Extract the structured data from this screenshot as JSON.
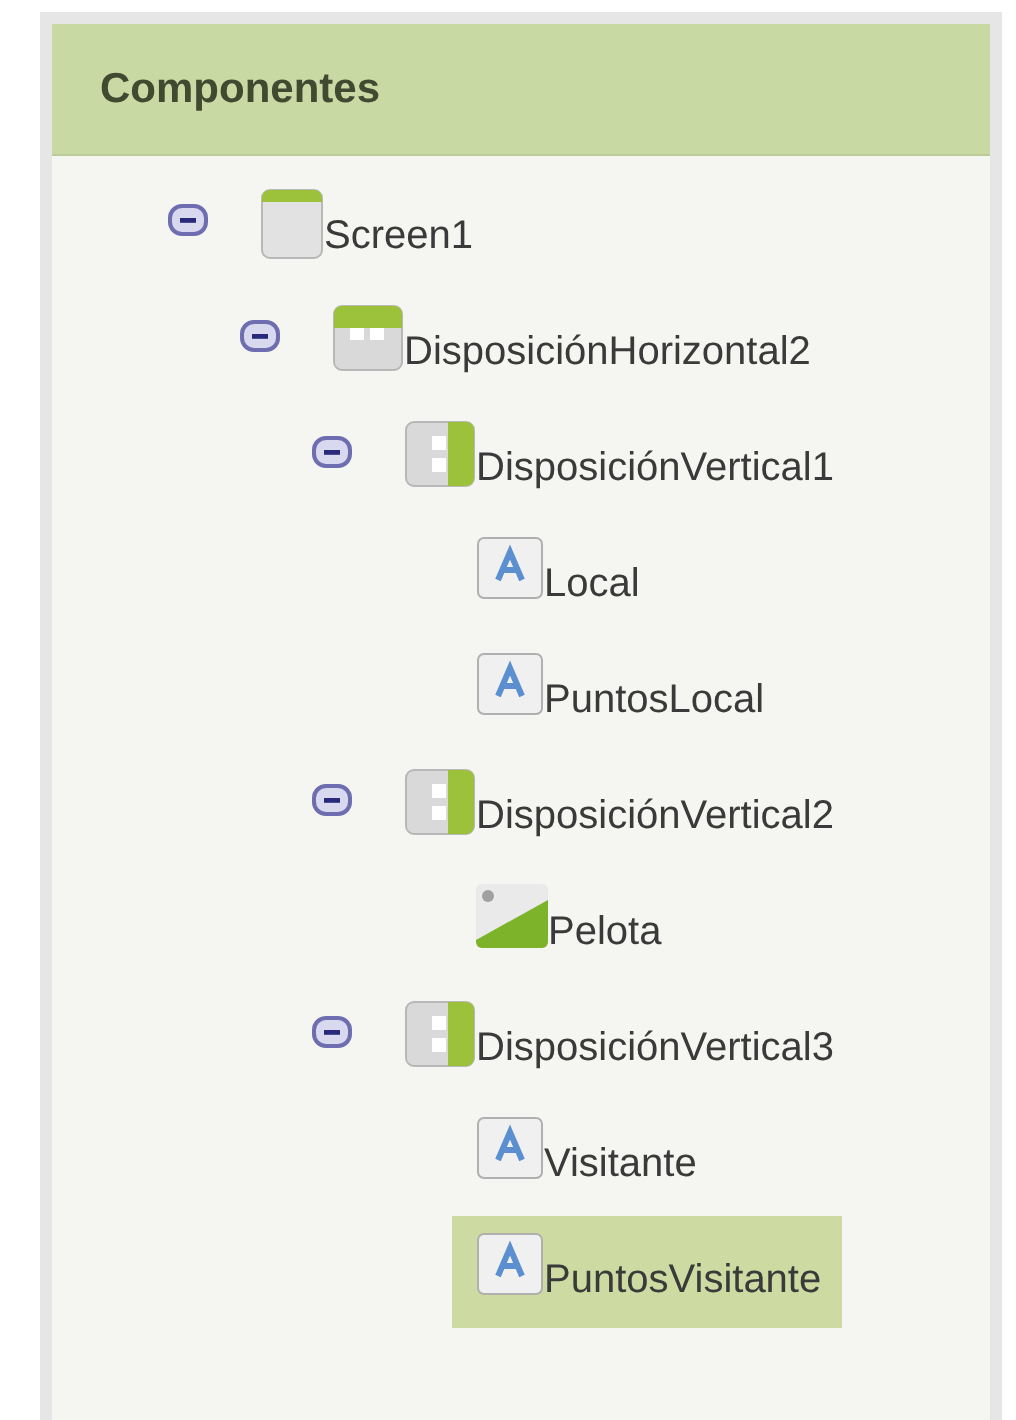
{
  "panel": {
    "title": "Componentes"
  },
  "tree": [
    {
      "name": "Screen1",
      "kind": "screen",
      "expanded": true,
      "selected": false,
      "children": [
        {
          "name": "DisposiciónHorizontal2",
          "kind": "horizontal",
          "expanded": true,
          "selected": false,
          "children": [
            {
              "name": "DisposiciónVertical1",
              "kind": "vertical",
              "expanded": true,
              "selected": false,
              "children": [
                {
                  "name": "Local",
                  "kind": "label",
                  "selected": false
                },
                {
                  "name": "PuntosLocal",
                  "kind": "label",
                  "selected": false
                }
              ]
            },
            {
              "name": "DisposiciónVertical2",
              "kind": "vertical",
              "expanded": true,
              "selected": false,
              "children": [
                {
                  "name": "Pelota",
                  "kind": "image",
                  "selected": false
                }
              ]
            },
            {
              "name": "DisposiciónVertical3",
              "kind": "vertical",
              "expanded": true,
              "selected": false,
              "children": [
                {
                  "name": "Visitante",
                  "kind": "label",
                  "selected": false
                },
                {
                  "name": "PuntosVisitante",
                  "kind": "label",
                  "selected": true
                }
              ]
            }
          ]
        }
      ]
    }
  ]
}
